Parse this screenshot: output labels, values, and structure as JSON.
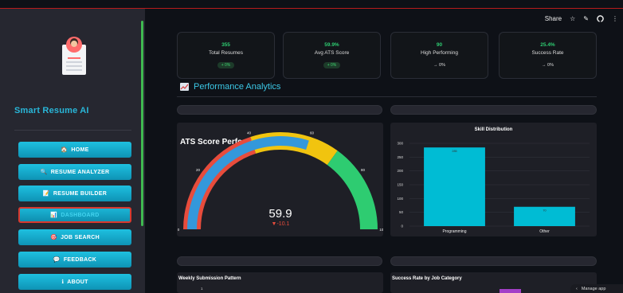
{
  "header": {
    "share_label": "Share",
    "icons": [
      "star-icon",
      "edit-icon",
      "github-icon",
      "more-icon"
    ]
  },
  "sidebar": {
    "brand": "Smart Resume AI",
    "nav": [
      {
        "label": "HOME",
        "icon": "🏠"
      },
      {
        "label": "RESUME ANALYZER",
        "icon": "🔍"
      },
      {
        "label": "RESUME BUILDER",
        "icon": "📝"
      },
      {
        "label": "DASHBOARD",
        "icon": "📊"
      },
      {
        "label": "JOB SEARCH",
        "icon": "🎯"
      },
      {
        "label": "FEEDBACK",
        "icon": "💬"
      },
      {
        "label": "ABOUT",
        "icon": "ℹ"
      }
    ]
  },
  "metrics": [
    {
      "value": "355",
      "label": "Total Resumes",
      "delta": "+ 0%"
    },
    {
      "value": "59.9%",
      "label": "Avg ATS Score",
      "delta": "+ 0%"
    },
    {
      "value": "90",
      "label": "High Performing",
      "delta": "→ 0%"
    },
    {
      "value": "25.4%",
      "label": "Success Rate",
      "delta": "→ 0%"
    }
  ],
  "section_title": "Performance Analytics",
  "gauge": {
    "title": "ATS Score Performance",
    "value": "59.9",
    "delta": "▼-10.1",
    "min": 0,
    "max": 100,
    "ticks": [
      "0",
      "20",
      "40",
      "60",
      "80",
      "100"
    ],
    "bands": [
      {
        "from": 0,
        "to": 40,
        "color": "#e74c3c"
      },
      {
        "from": 40,
        "to": 70,
        "color": "#f1c40f"
      },
      {
        "from": 70,
        "to": 100,
        "color": "#2ecc71"
      }
    ],
    "bar_color": "#3498db"
  },
  "chart_data": {
    "type": "bar",
    "title": "Skill Distribution",
    "categories": [
      "Programming",
      "Other"
    ],
    "values": [
      285,
      70
    ],
    "ylim": [
      0,
      300
    ],
    "yticks": [
      "0",
      "50",
      "100",
      "150",
      "200",
      "250",
      "300"
    ],
    "bar_labels": [
      "285",
      "70"
    ],
    "color": "#00bcd4",
    "grid": true
  },
  "bottom": {
    "left_title": "Weekly Submission Pattern",
    "right_title": "Success Rate by Job Category",
    "left_tick": "1"
  },
  "manage_app": "Manage app"
}
